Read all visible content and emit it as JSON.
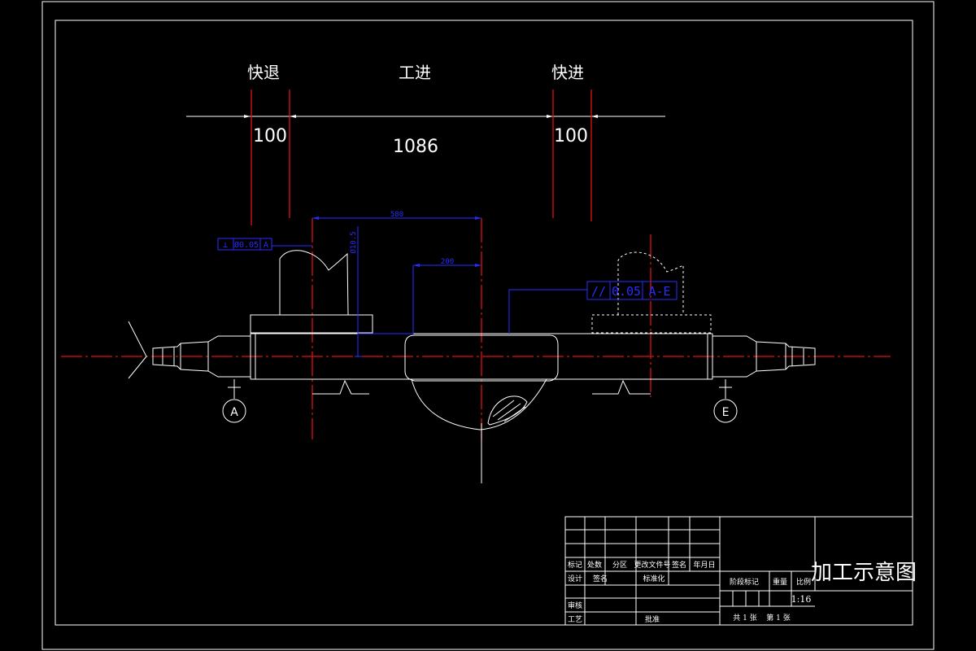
{
  "stage_labels": {
    "fast_return": "快退",
    "work_feed": "工进",
    "fast_feed": "快进"
  },
  "stroke_dims": {
    "return_len": "100",
    "feed_len": "1086",
    "fast_len": "100"
  },
  "blue_dims": {
    "overall": "580",
    "partial": "200",
    "vertical": "Ø10.5"
  },
  "tolerances": {
    "perpendicular": {
      "symbol": "⊥",
      "value": "Ø0.05",
      "datum": "A"
    },
    "parallel": {
      "symbol": "//",
      "value": "0.05",
      "datum": "A-E"
    }
  },
  "datums": [
    "A",
    "E"
  ],
  "title_block": {
    "drawing_title": "加工示意图",
    "scale_value": "1:16",
    "header_labels": [
      "标记",
      "处数",
      "分区",
      "更改文件号",
      "签名",
      "年月日"
    ],
    "row_design": [
      "设计",
      "签名",
      "标准化"
    ],
    "row_check": "审核",
    "row_process": "工艺",
    "row_approve": "批准",
    "stage_mark": "阶段标记",
    "weight": "重量",
    "scale_label": "比例",
    "sheets_total": "共 1 张",
    "sheet_no": "第 1 张"
  }
}
